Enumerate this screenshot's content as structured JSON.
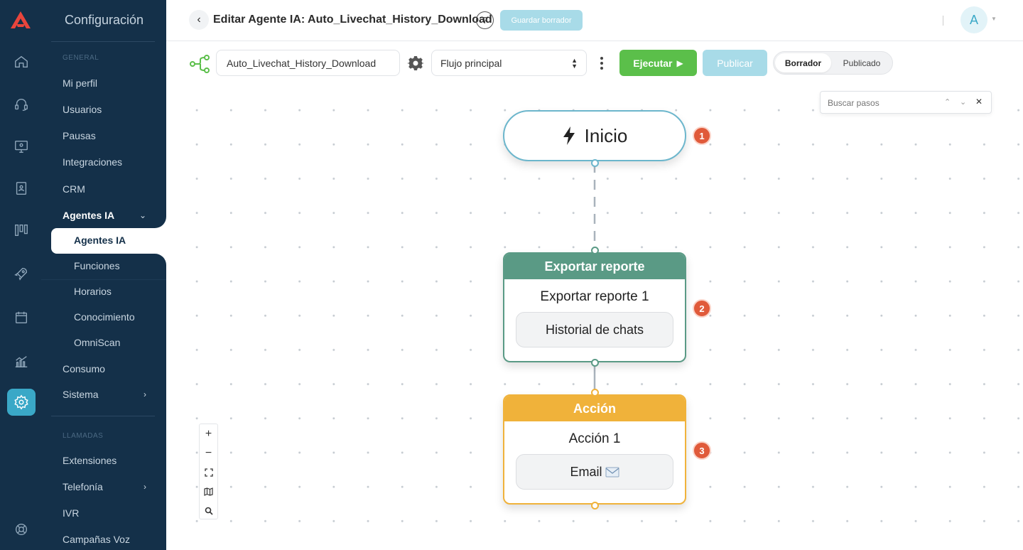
{
  "sidebar": {
    "title": "Configuración",
    "section_general": "GENERAL",
    "section_calls": "LLAMADAS",
    "items": {
      "mi_perfil": "Mi perfil",
      "usuarios": "Usuarios",
      "pausas": "Pausas",
      "integraciones": "Integraciones",
      "crm": "CRM",
      "agentes_ia": "Agentes IA",
      "agentes_ia_sub": "Agentes IA",
      "funciones": "Funciones",
      "horarios": "Horarios",
      "conocimiento": "Conocimiento",
      "omniscan": "OmniScan",
      "consumo": "Consumo",
      "sistema": "Sistema",
      "extensiones": "Extensiones",
      "telefonia": "Telefonía",
      "ivr": "IVR",
      "campanas_voz": "Campañas Voz"
    }
  },
  "header": {
    "title": "Editar Agente IA: Auto_Livechat_History_Download",
    "help": "?",
    "save_draft": "Guardar borrador",
    "avatar_initial": "A"
  },
  "toolbar": {
    "flow_name": "Auto_Livechat_History_Download",
    "flow_select": "Flujo principal",
    "run": "Ejecutar",
    "publish": "Publicar",
    "toggle_draft": "Borrador",
    "toggle_published": "Publicado"
  },
  "search": {
    "placeholder": "Buscar pasos"
  },
  "nodes": {
    "start": {
      "label": "Inicio",
      "badge": "1"
    },
    "export": {
      "header": "Exportar reporte",
      "name": "Exportar reporte 1",
      "pill": "Historial de chats",
      "badge": "2"
    },
    "action": {
      "header": "Acción",
      "name": "Acción 1",
      "pill": "Email",
      "badge": "3"
    }
  },
  "colors": {
    "sidebar_bg": "#143049",
    "accent": "#3aa8c7",
    "run_green": "#5bbf4a",
    "export_header": "#5a9a85",
    "action_header": "#f0b23a",
    "badge_red": "#e05a3a"
  }
}
